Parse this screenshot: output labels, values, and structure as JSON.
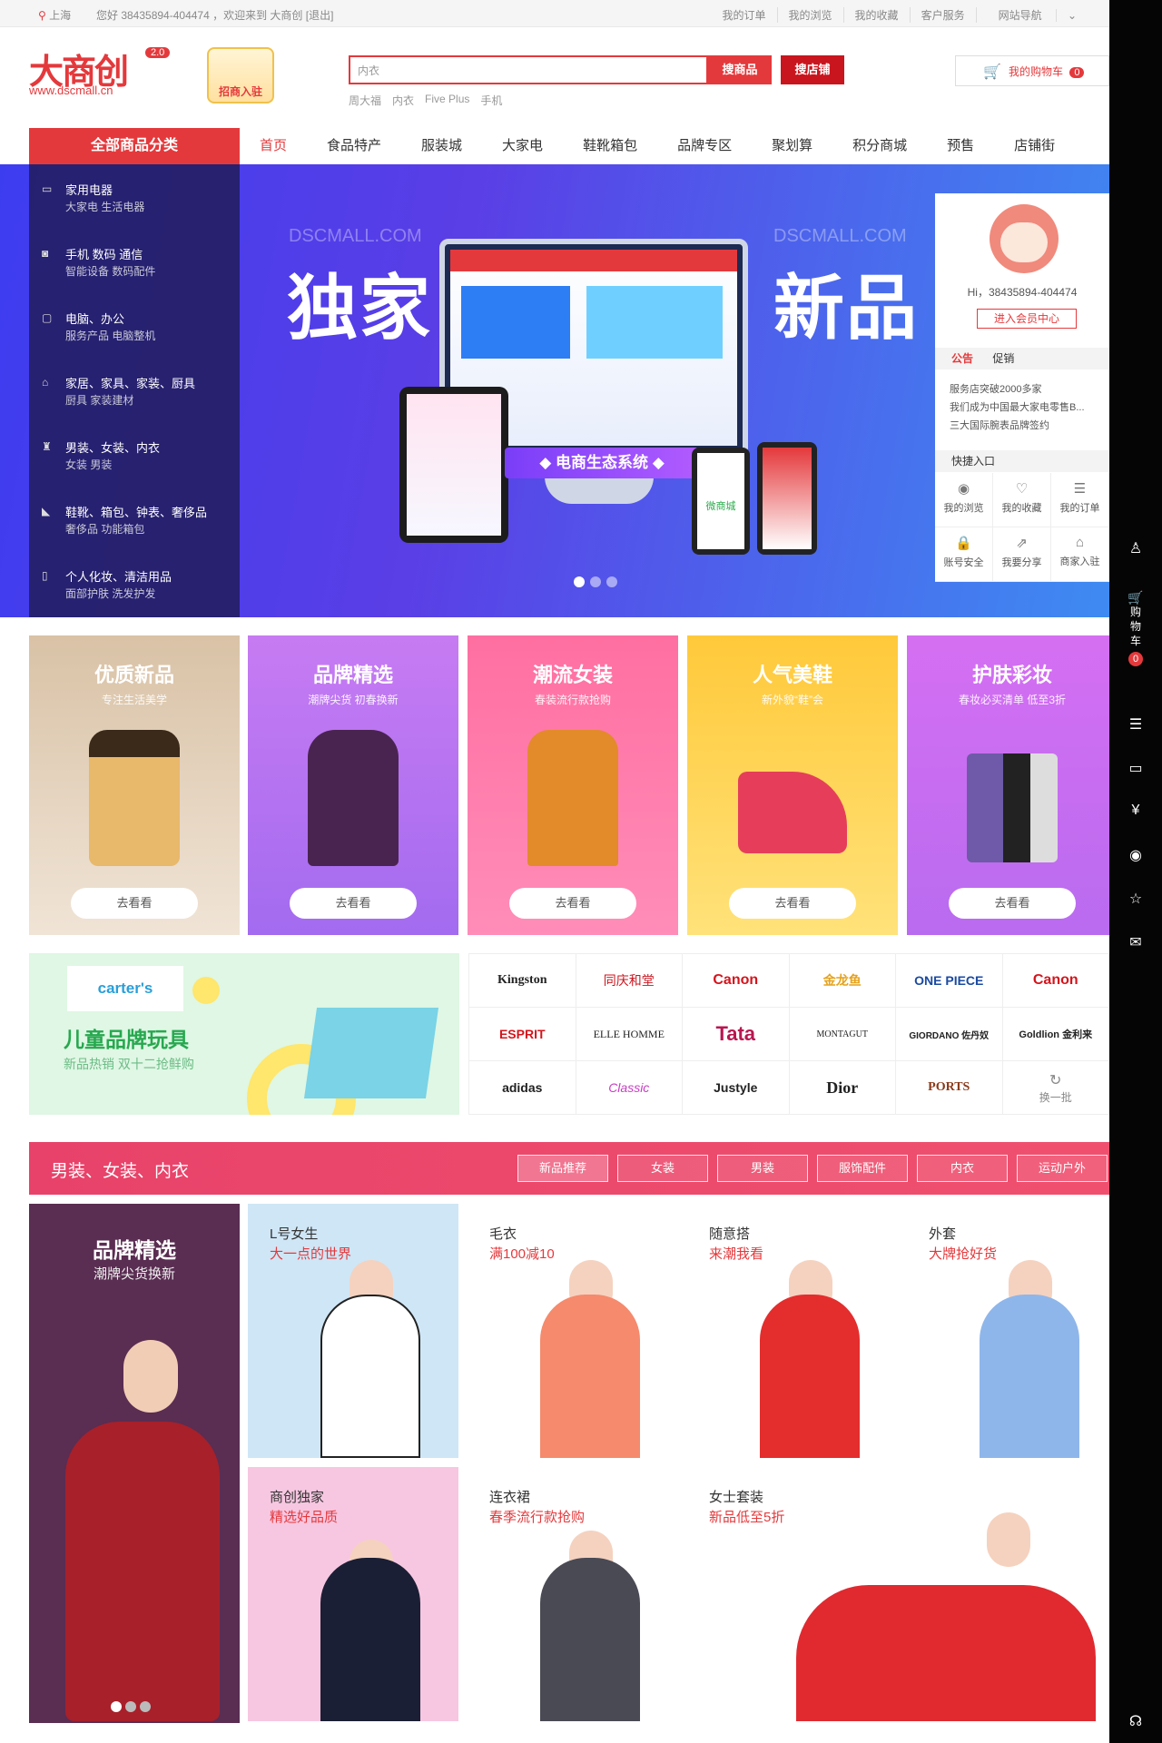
{
  "topbar": {
    "location": "上海",
    "welcome": "您好 38435894-404474 ，欢迎来到 大商创 [退出]",
    "links": [
      "我的订单",
      "我的浏览",
      "我的收藏",
      "客户服务",
      "网站导航"
    ]
  },
  "header": {
    "logo_text": "大商创",
    "logo_version": "2.0",
    "logo_url": "www.dscmall.cn",
    "zhaoshang": "招商入驻",
    "search_value": "内衣",
    "search_goods_label": "搜商品",
    "search_shop_label": "搜店铺",
    "hotwords": [
      "周大福",
      "内衣",
      "Five Plus",
      "手机"
    ],
    "cart_label": "我的购物车",
    "cart_count": "0"
  },
  "nav": {
    "all_categories": "全部商品分类",
    "items": [
      "首页",
      "食品特产",
      "服装城",
      "大家电",
      "鞋靴箱包",
      "品牌专区",
      "聚划算",
      "积分商城",
      "预售",
      "店铺街"
    ]
  },
  "categories": [
    {
      "main": "家用电器",
      "sub": "大家电   生活电器",
      "icon": "tv-icon"
    },
    {
      "main": "手机   数码   通信",
      "sub": "智能设备   数码配件",
      "icon": "camera-icon"
    },
    {
      "main": "电脑、办公",
      "sub": "服务产品   电脑整机",
      "icon": "monitor-icon"
    },
    {
      "main": "家居、家具、家装、厨具",
      "sub": "厨具   家装建材",
      "icon": "sofa-icon"
    },
    {
      "main": "男装、女装、内衣",
      "sub": "女装   男装",
      "icon": "shirt-icon"
    },
    {
      "main": "鞋靴、箱包、钟表、奢侈品",
      "sub": "奢侈品   功能箱包",
      "icon": "shoe-icon"
    },
    {
      "main": "个人化妆、清洁用品",
      "sub": "面部护肤   洗发护发",
      "icon": "bottle-icon"
    }
  ],
  "banner": {
    "watermark_left": "DSCMALL.COM",
    "watermark_right": "DSCMALL.COM",
    "title_left": "独家",
    "title_right": "新品",
    "eco_tag": "◆ 电商生态系统 ◆",
    "wechat_label": "微商城"
  },
  "member": {
    "greeting": "Hi，38435894-404474",
    "center_button": "进入会员中心",
    "tab_notice": "公告",
    "tab_promo": "促销",
    "news": [
      "服务店突破2000多家",
      "我们成为中国最大家电零售B...",
      "三大国际腕表品牌签约"
    ],
    "quick_title": "快捷入口",
    "quick": [
      {
        "label": "我的浏览",
        "icon": "eye-icon"
      },
      {
        "label": "我的收藏",
        "icon": "heart-icon"
      },
      {
        "label": "我的订单",
        "icon": "list-icon"
      },
      {
        "label": "账号安全",
        "icon": "lock-icon"
      },
      {
        "label": "我要分享",
        "icon": "share-icon"
      },
      {
        "label": "商家入驻",
        "icon": "store-icon"
      }
    ]
  },
  "promo_cards": [
    {
      "title": "优质新品",
      "sub": "专注生活美学",
      "go": "去看看",
      "bg": "#d9c2a6"
    },
    {
      "title": "品牌精选",
      "sub": "潮牌尖货 初春换新",
      "go": "去看看",
      "bg": "#c77bf2"
    },
    {
      "title": "潮流女装",
      "sub": "春装流行款抢购",
      "go": "去看看",
      "bg": "#ff6fa1"
    },
    {
      "title": "人气美鞋",
      "sub": "新外貌“鞋”会",
      "go": "去看看",
      "bg": "#ffc93a"
    },
    {
      "title": "护肤彩妆",
      "sub": "春妆必买清单 低至3折",
      "go": "去看看",
      "bg": "#d56ff2"
    }
  ],
  "kids": {
    "brand": "carter's",
    "title": "儿童品牌玩具",
    "sub": "新品热销 双十二抢鲜购"
  },
  "brands": [
    "Kingston",
    "同庆和堂",
    "Canon",
    "金龙鱼",
    "ONE PIECE",
    "Canon",
    "ESPRIT",
    "ELLE HOMME",
    "Tata",
    "MONTAGUT",
    "GIORDANO 佐丹奴",
    "Goldlion 金利来",
    "adidas",
    "Classic",
    "Justyle",
    "Dior",
    "PORTS",
    "换一批"
  ],
  "section": {
    "title": "男装、女装、内衣",
    "tabs": [
      "新品推荐",
      "女装",
      "男装",
      "服饰配件",
      "内衣",
      "运动户外"
    ],
    "brand_title": "品牌精选",
    "brand_sub": "潮牌尖货换新",
    "products": [
      {
        "name": "L号女生",
        "desc": "大一点的世界"
      },
      {
        "name": "毛衣",
        "desc": "满100减10"
      },
      {
        "name": "随意搭",
        "desc": "来潮我看"
      },
      {
        "name": "外套",
        "desc": "大牌抢好货"
      },
      {
        "name": "商创独家",
        "desc": "精选好品质"
      },
      {
        "name": "连衣裙",
        "desc": "春季流行款抢购"
      },
      {
        "name": "女士套装",
        "desc": "新品低至5折"
      }
    ]
  },
  "sidebar": {
    "cart_label": "购物车",
    "cart_count": "0"
  },
  "colors": {
    "accent": "#e4393c",
    "section": "#e8426a"
  }
}
